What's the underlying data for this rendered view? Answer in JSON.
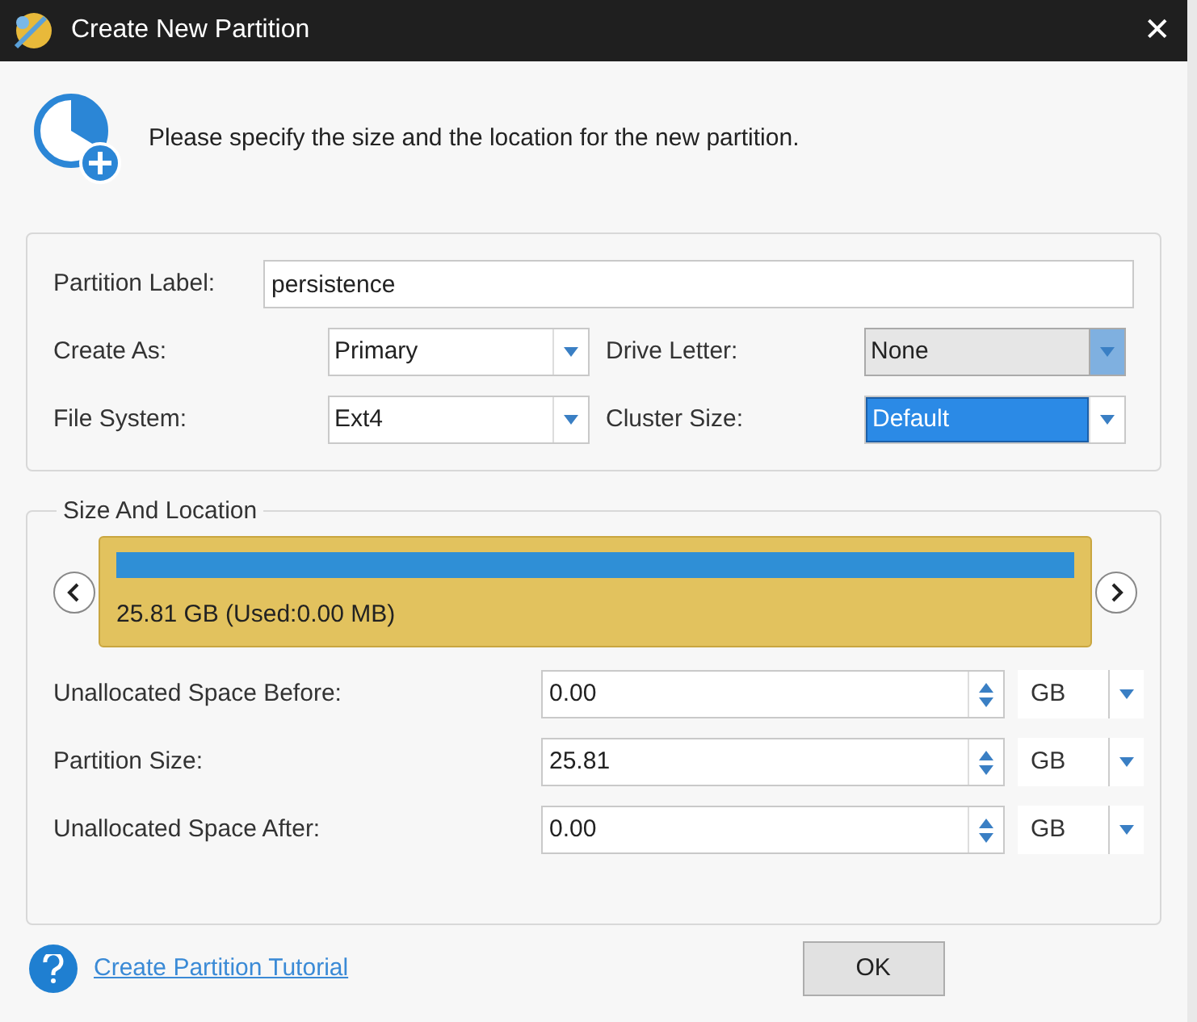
{
  "window": {
    "title": "Create New Partition",
    "close": "✕"
  },
  "intro": "Please specify the size and the location for the new partition.",
  "partition_label": {
    "label": "Partition Label:",
    "value": "persistence"
  },
  "options": [
    {
      "label": "Create As:",
      "value": "Primary",
      "disabled": false,
      "selected": false
    },
    {
      "label": "Drive Letter:",
      "value": "None",
      "disabled": true,
      "selected": false
    },
    {
      "label": "File System:",
      "value": "Ext4",
      "disabled": false,
      "selected": false
    },
    {
      "label": "Cluster Size:",
      "value": "Default",
      "disabled": false,
      "selected": true
    }
  ],
  "size_and_location": {
    "title": "Size And Location",
    "partition": {
      "text": "25.81 GB (Used:0.00 MB)",
      "level": 1
    },
    "rows": [
      {
        "label": "Unallocated Space Before:",
        "value": "0.00",
        "unit": "GB"
      },
      {
        "label": "Partition Size:",
        "value": "25.81",
        "unit": "GB"
      },
      {
        "label": "Unallocated Space After:",
        "value": "0.00",
        "unit": "GB"
      }
    ]
  },
  "tutorial_link": "Create Partition Tutorial",
  "buttons": [
    "OK"
  ]
}
